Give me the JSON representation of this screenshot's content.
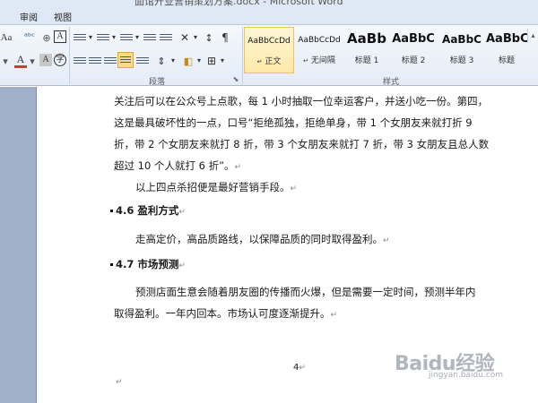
{
  "window": {
    "title": "面馆开业营销策划方案.docx - Microsoft Word"
  },
  "tabs": [
    {
      "label": "审阅"
    },
    {
      "label": "视图"
    }
  ],
  "ribbon": {
    "groups": {
      "paragraph": "段落",
      "styles": "样式"
    },
    "font_color": "A",
    "font_char_shading": "A",
    "font_aa": "Aa",
    "font_box_char": "A",
    "styles": [
      {
        "sample": "AaBbCcDd",
        "name": "正文",
        "selected": true
      },
      {
        "sample": "AaBbCcDd",
        "name": "无间隔",
        "selected": false
      },
      {
        "sample": "AaBb",
        "name": "标题 1",
        "selected": false
      },
      {
        "sample": "AaBbC",
        "name": "标题 2",
        "selected": false
      },
      {
        "sample": "AaBbC",
        "name": "标题 3",
        "selected": false
      },
      {
        "sample": "AaBbC",
        "name": "标题",
        "selected": false
      }
    ]
  },
  "document": {
    "p1": [
      "关注后可以在公众号上点歌，每 1 小时抽取一位幸运客户，并送小吃一份。第四，",
      "这是最具破坏性的一点，口号“拒绝孤独，拒绝单身，带 1 个女朋友来就打折 9",
      "折，带 2 个女朋友来就打 8 折，带 3 个女朋友来就打 7 折，带 3 女朋友且总人数",
      "超过 10 个人就打 6 折”。"
    ],
    "p2": "以上四点杀招便是最好营销手段。",
    "h1": "4.6 盈利方式",
    "p3": "走高定价，高品质路线，以保障品质的同时取得盈利。",
    "h2": "4.7 市场预测",
    "p4": [
      "预测店面生意会随着朋友圈的传播而火爆，但是需要一定时间，预测半年内",
      "取得盈利。一年内回本。市场认可度逐渐提升。"
    ],
    "page_number": "4",
    "para_mark": "↵"
  },
  "watermark": {
    "text": "Baidu经验",
    "sub": "jingyan.baidu.com"
  }
}
